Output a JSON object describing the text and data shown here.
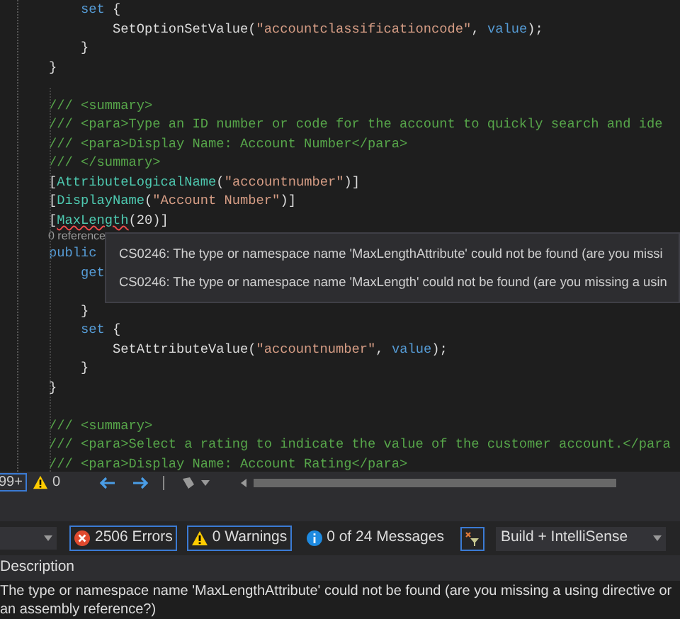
{
  "code_lines": [
    {
      "kind": "code",
      "tokens": [
        {
          "kind": "keyword",
          "text": "        set"
        },
        {
          "kind": "plain",
          "text": " {"
        }
      ]
    },
    {
      "kind": "code",
      "tokens": [
        {
          "kind": "plain",
          "text": "            SetOptionSetValue("
        },
        {
          "kind": "string",
          "text": "\"accountclassificationcode\""
        },
        {
          "kind": "plain",
          "text": ", "
        },
        {
          "kind": "keyword",
          "text": "value"
        },
        {
          "kind": "plain",
          "text": ");"
        }
      ]
    },
    {
      "kind": "code",
      "tokens": [
        {
          "kind": "plain",
          "text": "        }"
        }
      ]
    },
    {
      "kind": "code",
      "tokens": [
        {
          "kind": "plain",
          "text": "    }"
        }
      ]
    },
    {
      "kind": "blank"
    },
    {
      "kind": "code",
      "tokens": [
        {
          "kind": "comment",
          "text": "    /// <summary>"
        }
      ]
    },
    {
      "kind": "code",
      "tokens": [
        {
          "kind": "comment",
          "text": "    /// <para>Type an ID number or code for the account to quickly search and ide"
        }
      ]
    },
    {
      "kind": "code",
      "tokens": [
        {
          "kind": "comment",
          "text": "    /// <para>Display Name: Account Number</para>"
        }
      ]
    },
    {
      "kind": "code",
      "tokens": [
        {
          "kind": "comment",
          "text": "    /// </summary>"
        }
      ]
    },
    {
      "kind": "code",
      "tokens": [
        {
          "kind": "plain",
          "text": "    ["
        },
        {
          "kind": "type",
          "text": "AttributeLogicalName"
        },
        {
          "kind": "plain",
          "text": "("
        },
        {
          "kind": "string",
          "text": "\"accountnumber\""
        },
        {
          "kind": "plain",
          "text": ")]"
        }
      ]
    },
    {
      "kind": "code",
      "tokens": [
        {
          "kind": "plain",
          "text": "    ["
        },
        {
          "kind": "type",
          "text": "DisplayName"
        },
        {
          "kind": "plain",
          "text": "("
        },
        {
          "kind": "string",
          "text": "\"Account Number\""
        },
        {
          "kind": "plain",
          "text": ")]"
        }
      ]
    },
    {
      "kind": "code",
      "tokens": [
        {
          "kind": "plain",
          "text": "    ["
        },
        {
          "kind": "error",
          "text": "MaxLength"
        },
        {
          "kind": "plain",
          "text": "(20)]"
        }
      ]
    },
    {
      "kind": "codelens",
      "text": "0 reference"
    },
    {
      "kind": "code",
      "tokens": [
        {
          "kind": "keyword",
          "text": "    public"
        }
      ]
    },
    {
      "kind": "code",
      "tokens": [
        {
          "kind": "keyword",
          "text": "        get"
        }
      ]
    },
    {
      "kind": "blank"
    },
    {
      "kind": "code",
      "tokens": [
        {
          "kind": "plain",
          "text": "        }"
        }
      ]
    },
    {
      "kind": "code",
      "tokens": [
        {
          "kind": "keyword",
          "text": "        set"
        },
        {
          "kind": "plain",
          "text": " {"
        }
      ]
    },
    {
      "kind": "code",
      "tokens": [
        {
          "kind": "plain",
          "text": "            SetAttributeValue("
        },
        {
          "kind": "string",
          "text": "\"accountnumber\""
        },
        {
          "kind": "plain",
          "text": ", "
        },
        {
          "kind": "keyword",
          "text": "value"
        },
        {
          "kind": "plain",
          "text": ");"
        }
      ]
    },
    {
      "kind": "code",
      "tokens": [
        {
          "kind": "plain",
          "text": "        }"
        }
      ]
    },
    {
      "kind": "code",
      "tokens": [
        {
          "kind": "plain",
          "text": "    }"
        }
      ]
    },
    {
      "kind": "blank"
    },
    {
      "kind": "code",
      "tokens": [
        {
          "kind": "comment",
          "text": "    /// <summary>"
        }
      ]
    },
    {
      "kind": "code",
      "tokens": [
        {
          "kind": "comment",
          "text": "    /// <para>Select a rating to indicate the value of the customer account.</para"
        }
      ]
    },
    {
      "kind": "code",
      "tokens": [
        {
          "kind": "comment",
          "text": "    /// <para>Display Name: Account Rating</para>"
        }
      ]
    }
  ],
  "tooltip": [
    "CS0246: The type or namespace name 'MaxLengthAttribute' could not be found (are you missi",
    "CS0246: The type or namespace name 'MaxLength' could not be found (are you missing a usin"
  ],
  "status_bar": {
    "errors": "99+",
    "warnings": "0"
  },
  "error_list": {
    "errors": "2506 Errors",
    "warnings": "0 Warnings",
    "messages": "0 of 24 Messages",
    "source": "Build + IntelliSense",
    "column": "Description",
    "rows": [
      "The type or namespace name 'MaxLengthAttribute' could not be found (are you missing a using directive or an assembly reference?)"
    ]
  }
}
